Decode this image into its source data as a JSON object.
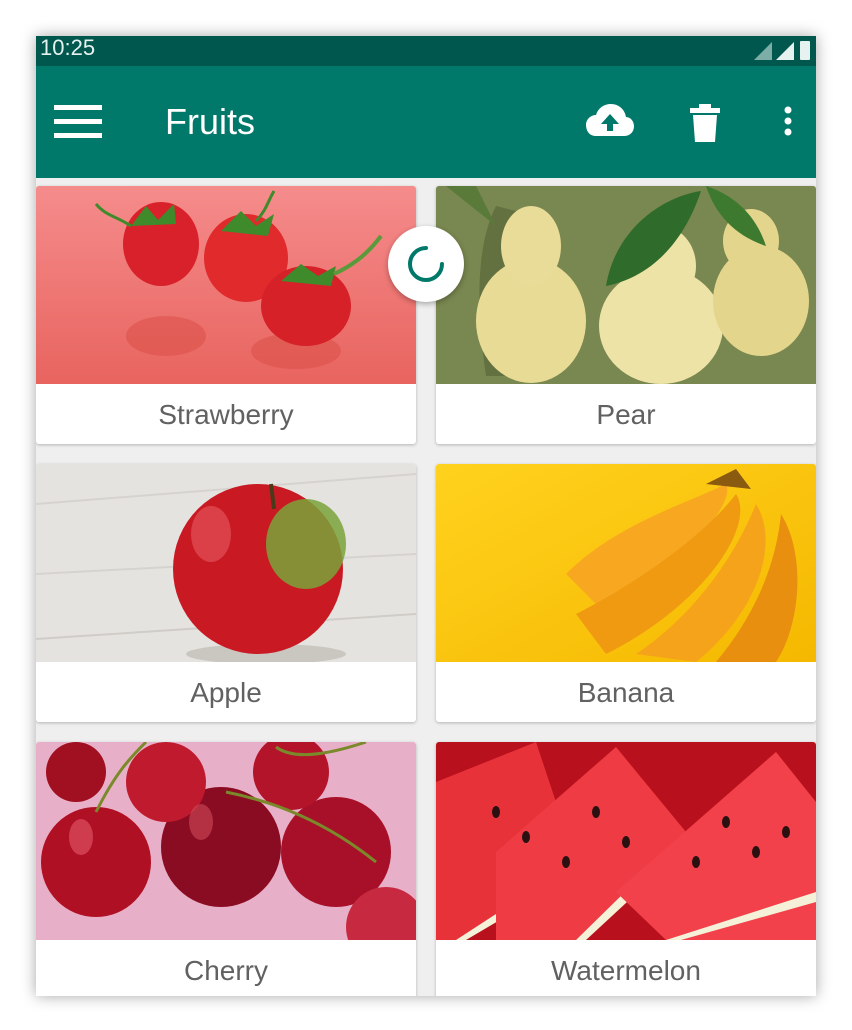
{
  "status_bar": {
    "time": "10:25"
  },
  "app_bar": {
    "title": "Fruits",
    "icons": [
      "menu-icon",
      "cloud-upload-icon",
      "delete-icon",
      "more-vert-icon"
    ]
  },
  "colors": {
    "primary": "#00796b",
    "primary_dark": "#00574d",
    "label_text": "#616161",
    "background": "#efefef"
  },
  "fruits": [
    {
      "name": "Strawberry"
    },
    {
      "name": "Pear"
    },
    {
      "name": "Apple"
    },
    {
      "name": "Banana"
    },
    {
      "name": "Cherry"
    },
    {
      "name": "Watermelon"
    }
  ]
}
